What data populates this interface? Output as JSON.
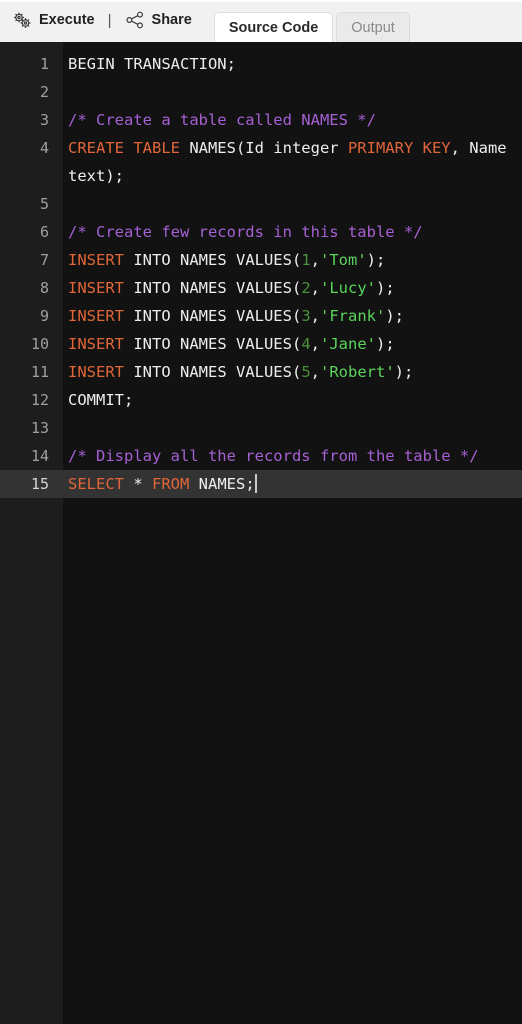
{
  "toolbar": {
    "execute_label": "Execute",
    "separator": "|",
    "share_label": "Share",
    "execute_icon": "gears-icon",
    "share_icon": "share-network-icon"
  },
  "tabs": [
    {
      "label": "Source Code",
      "active": true
    },
    {
      "label": "Output",
      "active": false
    }
  ],
  "editor": {
    "language": "sql",
    "active_line": 15,
    "cursor_after": "SELECT * FROM NAMES;",
    "total_lines": 15,
    "colors": {
      "background": "#121212",
      "gutter": "#1d1d1d",
      "active_line": "#333333",
      "keyword": "#e0663a",
      "comment": "#a560d4",
      "string": "#5ad45a",
      "number": "#49913a",
      "plain": "#eeeeee",
      "line_number": "#a0a0a0"
    },
    "lines": [
      {
        "n": "1",
        "tokens": [
          {
            "t": "txt",
            "v": "BEGIN TRANSACTION;"
          }
        ]
      },
      {
        "n": "2",
        "tokens": [
          {
            "t": "txt",
            "v": ""
          }
        ]
      },
      {
        "n": "3",
        "tokens": [
          {
            "t": "cmt",
            "v": "/* Create a table called NAMES */"
          }
        ]
      },
      {
        "n": "4",
        "tokens": [
          {
            "t": "kw",
            "v": "CREATE TABLE"
          },
          {
            "t": "txt",
            "v": " NAMES(Id integer "
          },
          {
            "t": "kw",
            "v": "PRIMARY KEY"
          },
          {
            "t": "txt",
            "v": ", Name text);"
          }
        ]
      },
      {
        "n": "5",
        "tokens": [
          {
            "t": "txt",
            "v": ""
          }
        ]
      },
      {
        "n": "6",
        "tokens": [
          {
            "t": "cmt",
            "v": "/* Create few records in this table */"
          }
        ]
      },
      {
        "n": "7",
        "tokens": [
          {
            "t": "kw",
            "v": "INSERT"
          },
          {
            "t": "txt",
            "v": " INTO NAMES VALUES("
          },
          {
            "t": "num",
            "v": "1"
          },
          {
            "t": "txt",
            "v": ","
          },
          {
            "t": "str",
            "v": "'Tom'"
          },
          {
            "t": "txt",
            "v": ");"
          }
        ]
      },
      {
        "n": "8",
        "tokens": [
          {
            "t": "kw",
            "v": "INSERT"
          },
          {
            "t": "txt",
            "v": " INTO NAMES VALUES("
          },
          {
            "t": "num",
            "v": "2"
          },
          {
            "t": "txt",
            "v": ","
          },
          {
            "t": "str",
            "v": "'Lucy'"
          },
          {
            "t": "txt",
            "v": ");"
          }
        ]
      },
      {
        "n": "9",
        "tokens": [
          {
            "t": "kw",
            "v": "INSERT"
          },
          {
            "t": "txt",
            "v": " INTO NAMES VALUES("
          },
          {
            "t": "num",
            "v": "3"
          },
          {
            "t": "txt",
            "v": ","
          },
          {
            "t": "str",
            "v": "'Frank'"
          },
          {
            "t": "txt",
            "v": ");"
          }
        ]
      },
      {
        "n": "10",
        "tokens": [
          {
            "t": "kw",
            "v": "INSERT"
          },
          {
            "t": "txt",
            "v": " INTO NAMES VALUES("
          },
          {
            "t": "num",
            "v": "4"
          },
          {
            "t": "txt",
            "v": ","
          },
          {
            "t": "str",
            "v": "'Jane'"
          },
          {
            "t": "txt",
            "v": ");"
          }
        ]
      },
      {
        "n": "11",
        "tokens": [
          {
            "t": "kw",
            "v": "INSERT"
          },
          {
            "t": "txt",
            "v": " INTO NAMES VALUES("
          },
          {
            "t": "num",
            "v": "5"
          },
          {
            "t": "txt",
            "v": ","
          },
          {
            "t": "str",
            "v": "'Robert'"
          },
          {
            "t": "txt",
            "v": ");"
          }
        ]
      },
      {
        "n": "12",
        "tokens": [
          {
            "t": "txt",
            "v": "COMMIT;"
          }
        ]
      },
      {
        "n": "13",
        "tokens": [
          {
            "t": "txt",
            "v": ""
          }
        ]
      },
      {
        "n": "14",
        "tokens": [
          {
            "t": "cmt",
            "v": "/* Display all the records from the table */"
          }
        ]
      },
      {
        "n": "15",
        "active": true,
        "caret": true,
        "tokens": [
          {
            "t": "kw",
            "v": "SELECT"
          },
          {
            "t": "txt",
            "v": " * "
          },
          {
            "t": "kw",
            "v": "FROM"
          },
          {
            "t": "txt",
            "v": " NAMES;"
          }
        ]
      }
    ]
  }
}
